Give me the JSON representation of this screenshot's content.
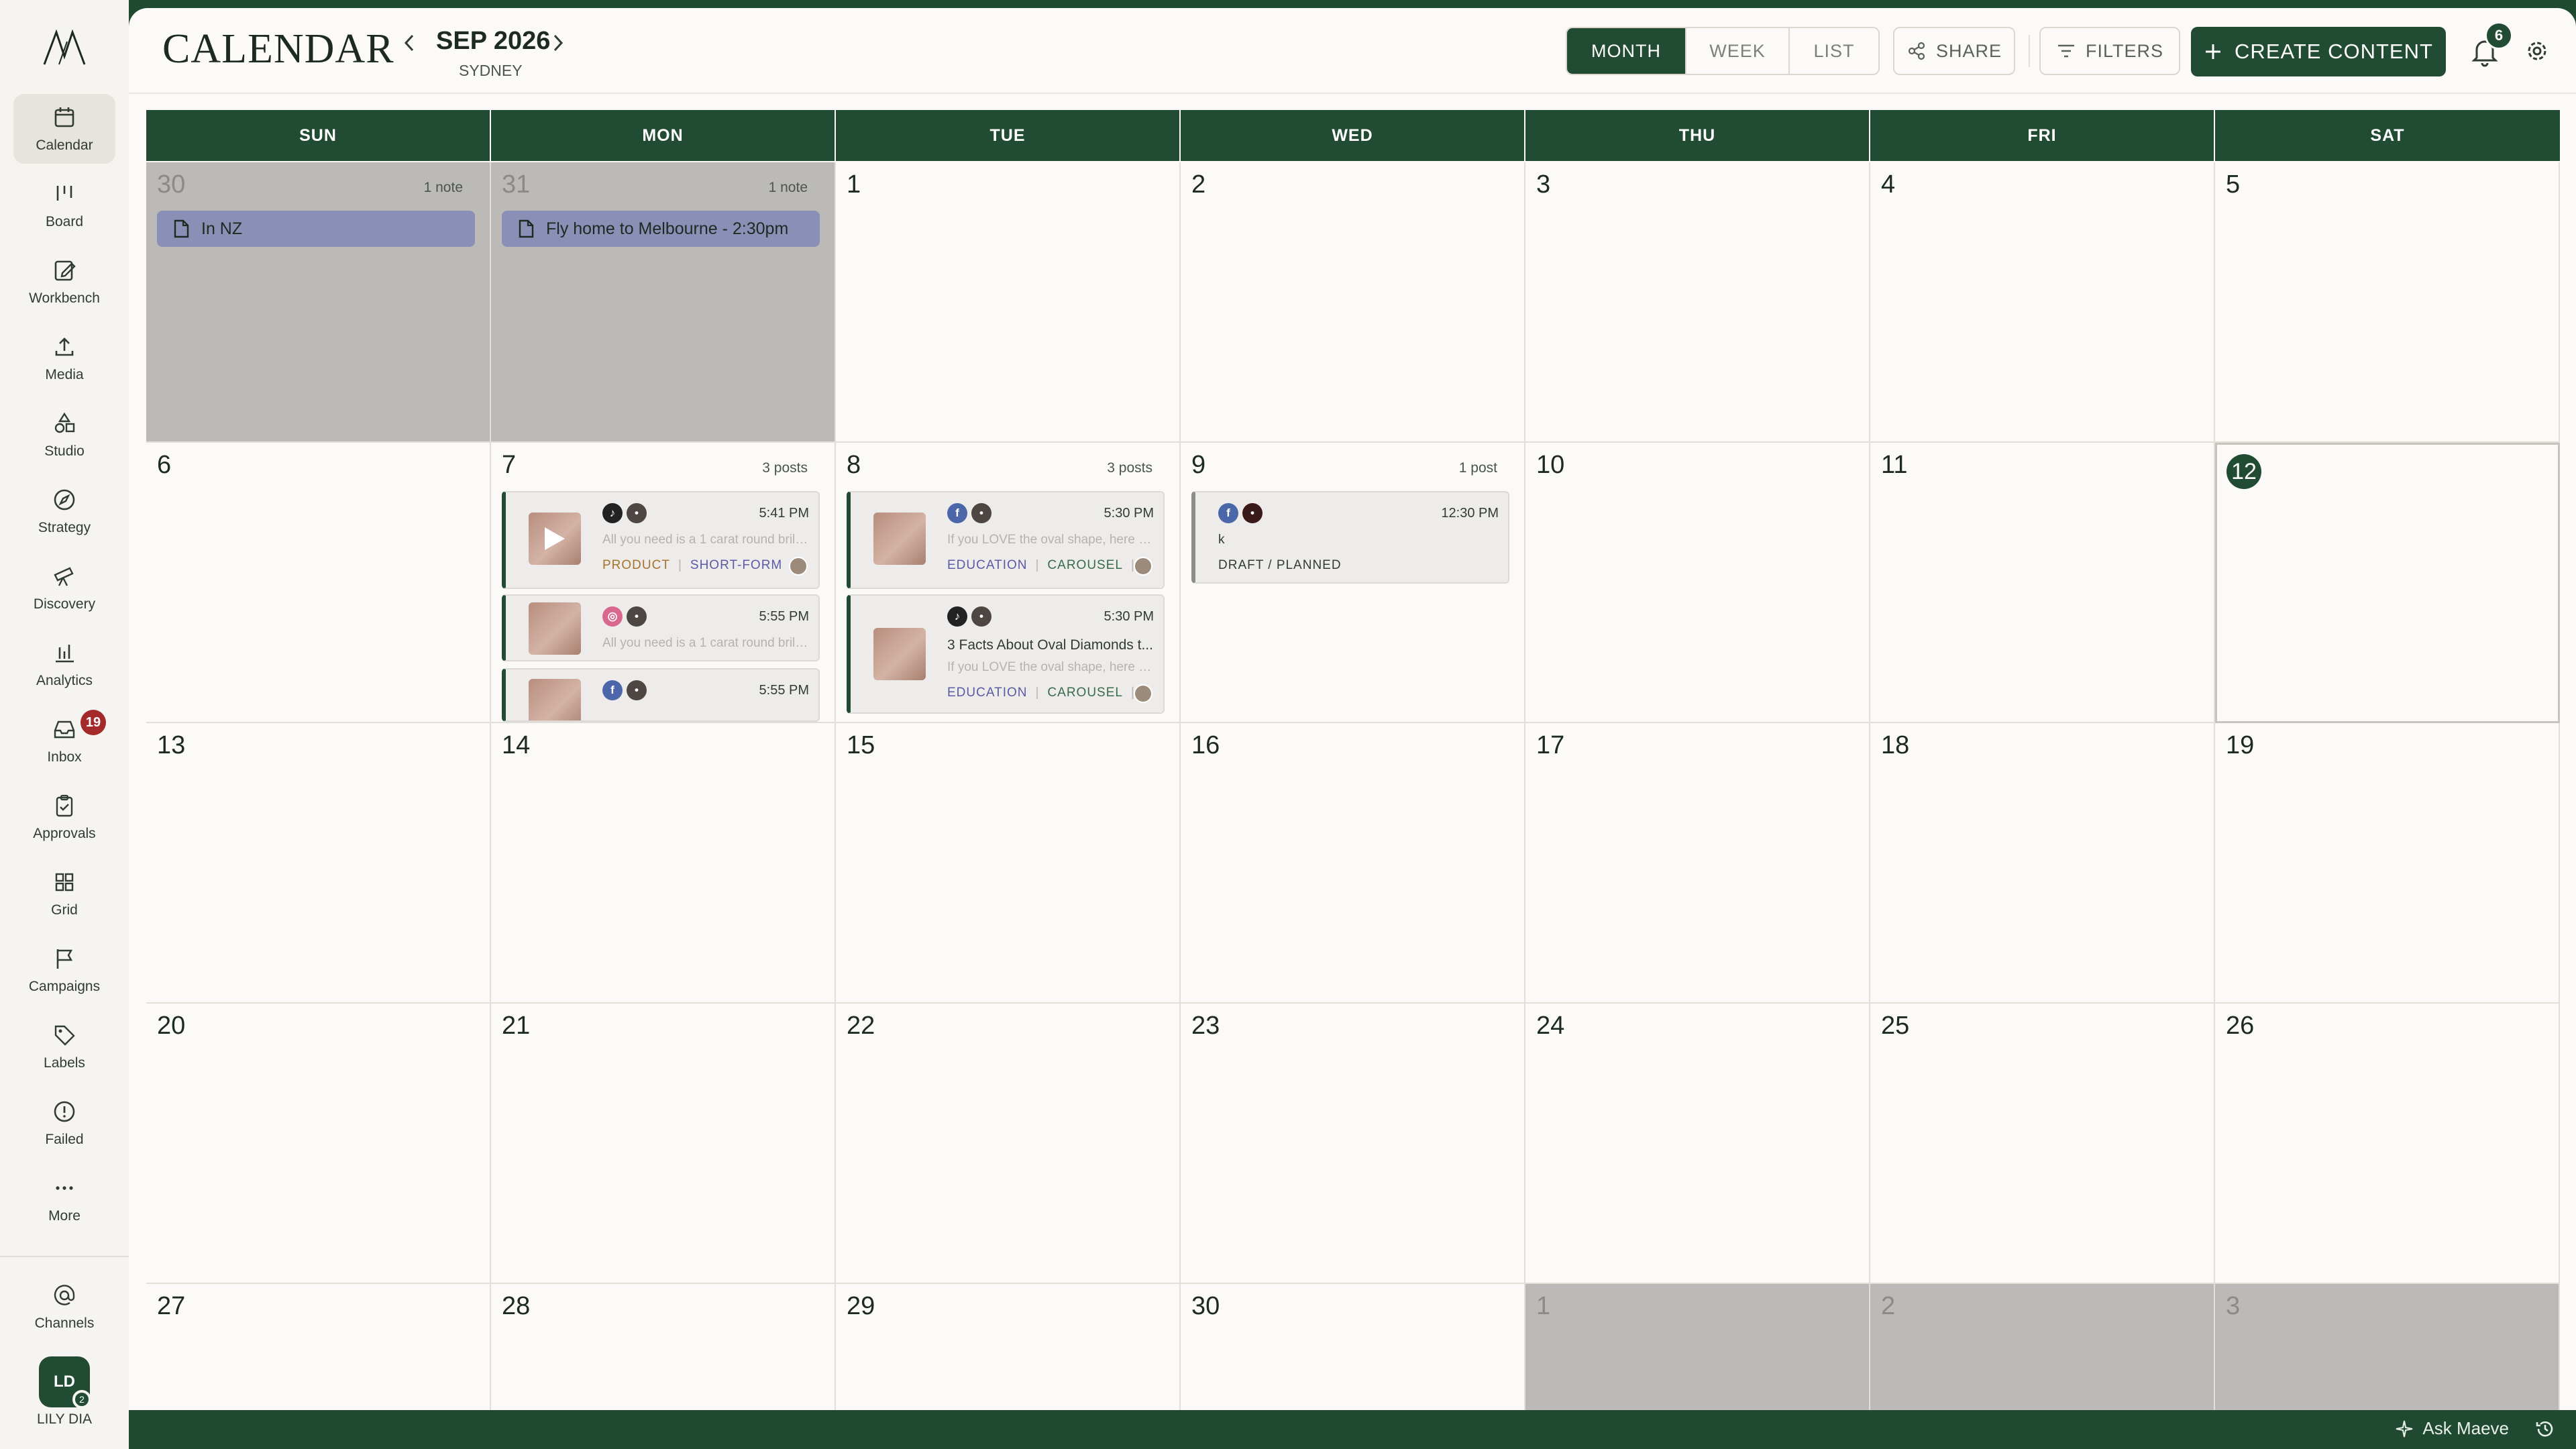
{
  "sidebar": {
    "items": [
      {
        "label": "Calendar",
        "icon": "calendar-icon",
        "active": true
      },
      {
        "label": "Board",
        "icon": "board-icon"
      },
      {
        "label": "Workbench",
        "icon": "workbench-icon"
      },
      {
        "label": "Media",
        "icon": "upload-icon"
      },
      {
        "label": "Studio",
        "icon": "shapes-icon"
      },
      {
        "label": "Strategy",
        "icon": "compass-icon"
      },
      {
        "label": "Discovery",
        "icon": "telescope-icon"
      },
      {
        "label": "Analytics",
        "icon": "bar-chart-icon"
      },
      {
        "label": "Inbox",
        "icon": "inbox-icon",
        "badge": "19"
      },
      {
        "label": "Approvals",
        "icon": "clipboard-check-icon"
      },
      {
        "label": "Grid",
        "icon": "grid-icon"
      },
      {
        "label": "Campaigns",
        "icon": "flag-icon"
      },
      {
        "label": "Labels",
        "icon": "tag-icon"
      },
      {
        "label": "Failed",
        "icon": "alert-circle-icon"
      },
      {
        "label": "More",
        "icon": "ellipsis-icon"
      }
    ],
    "channels_label": "Channels",
    "user_initials": "LD",
    "user_name": "LILY DIA",
    "user_dot": "2"
  },
  "header": {
    "title": "CALENDAR",
    "month": "SEP 2026",
    "timezone": "SYDNEY",
    "views": [
      "MONTH",
      "WEEK",
      "LIST"
    ],
    "active_view": "MONTH",
    "share_label": "SHARE",
    "filters_label": "FILTERS",
    "create_label": "CREATE CONTENT",
    "notifications": "6"
  },
  "footer": {
    "ask_label": "Ask Maeve"
  },
  "calendar": {
    "weekdays": [
      "SUN",
      "MON",
      "TUE",
      "WED",
      "THU",
      "FRI",
      "SAT"
    ],
    "weeks": [
      [
        "30",
        "31",
        "1",
        "2",
        "3",
        "4",
        "5"
      ],
      [
        "6",
        "7",
        "8",
        "9",
        "10",
        "11",
        "12"
      ],
      [
        "13",
        "14",
        "15",
        "16",
        "17",
        "18",
        "19"
      ],
      [
        "20",
        "21",
        "22",
        "23",
        "24",
        "25",
        "26"
      ],
      [
        "27",
        "28",
        "29",
        "30",
        "1",
        "2",
        "3"
      ]
    ],
    "today": "12",
    "day_counts": {
      "w0_d0": "1 note",
      "w0_d1": "1 note",
      "w1_d1": "3 posts",
      "w1_d2": "3 posts",
      "w1_d3": "1 post"
    },
    "notes": {
      "sun30": "In NZ",
      "mon31": "Fly home to Melbourne - 2:30pm"
    },
    "posts": {
      "mon7": [
        {
          "networks": [
            "tiktok",
            "account"
          ],
          "time": "5:41 PM",
          "caption": "All you need is a 1 carat round brilliant",
          "tags": [
            "PRODUCT",
            "SHORT-FORM"
          ],
          "video": true
        },
        {
          "networks": [
            "instagram",
            "account"
          ],
          "time": "5:55 PM",
          "caption": "All you need is a 1 carat round brilliant"
        },
        {
          "networks": [
            "facebook",
            "account"
          ],
          "time": "5:55 PM"
        }
      ],
      "tue8": [
        {
          "networks": [
            "facebook",
            "account"
          ],
          "time": "5:30 PM",
          "caption": "If you LOVE the oval shape, here are 3",
          "tags": [
            "EDUCATION",
            "CAROUSEL",
            "S"
          ]
        },
        {
          "networks": [
            "tiktok",
            "account"
          ],
          "time": "5:30 PM",
          "title": "3 Facts About Oval Diamonds t...",
          "caption": "If you LOVE the oval shape, here are 3",
          "tags": [
            "EDUCATION",
            "CAROUSEL",
            "S"
          ]
        }
      ],
      "wed9": [
        {
          "networks": [
            "facebook",
            "account"
          ],
          "time": "12:30 PM",
          "title": "k",
          "status": "DRAFT / PLANNED"
        }
      ]
    }
  },
  "colors": {
    "brand_green": "#214b33",
    "note_bg": "#8a8fb6",
    "badge_red": "#a3292a"
  }
}
